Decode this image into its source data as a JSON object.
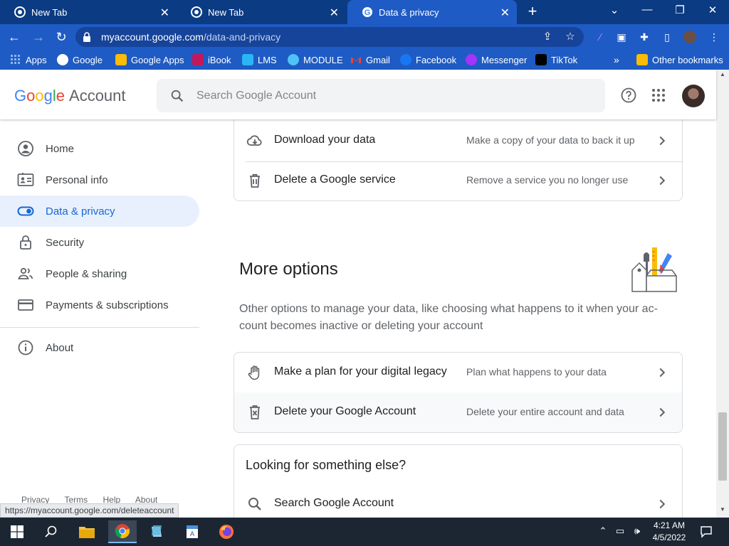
{
  "browser": {
    "tabs": [
      {
        "title": "New Tab",
        "active": false
      },
      {
        "title": "New Tab",
        "active": false
      },
      {
        "title": "Data & privacy",
        "active": true
      }
    ],
    "url_host": "myaccount.google.com",
    "url_path": "/data-and-privacy",
    "bookmarks": [
      "Apps",
      "Google",
      "Google Apps",
      "iBook",
      "LMS",
      "MODULE",
      "Gmail",
      "Facebook",
      "Messenger",
      "TikTok"
    ],
    "other_bookmarks": "Other bookmarks",
    "status_url": "https://myaccount.google.com/deleteaccount"
  },
  "header": {
    "logo_word": "Google",
    "logo_product": "Account",
    "search_placeholder": "Search Google Account"
  },
  "sidebar": {
    "items": [
      {
        "label": "Home",
        "icon": "home-icon"
      },
      {
        "label": "Personal info",
        "icon": "id-card-icon"
      },
      {
        "label": "Data & privacy",
        "icon": "toggle-icon",
        "active": true
      },
      {
        "label": "Security",
        "icon": "lock-icon"
      },
      {
        "label": "People & sharing",
        "icon": "people-icon"
      },
      {
        "label": "Payments & subscriptions",
        "icon": "credit-card-icon"
      }
    ],
    "about": "About",
    "footer": [
      "Privacy",
      "Terms",
      "Help",
      "About"
    ]
  },
  "main": {
    "top_rows": [
      {
        "title": "Download your data",
        "desc": "Make a copy of your data to back it up"
      },
      {
        "title": "Delete a Google service",
        "desc": "Remove a service you no longer use"
      }
    ],
    "more_options": {
      "title": "More options",
      "desc": "Other options to manage your data, like choosing what happens to it when your ac-count becomes inactive or deleting your account",
      "rows": [
        {
          "title": "Make a plan for your digital legacy",
          "desc": "Plan what happens to your data"
        },
        {
          "title": "Delete your Google Account",
          "desc": "Delete your entire account and data"
        }
      ]
    },
    "looking_else": {
      "title": "Looking for something else?",
      "search_row": "Search Google Account"
    }
  },
  "taskbar": {
    "time": "4:21 AM",
    "date": "4/5/2022"
  },
  "colors": {
    "tab_bar": "#0b3b82",
    "toolbar": "#1f5bc4",
    "active_nav_bg": "#e8f0fe",
    "active_nav_text": "#1967d2",
    "taskbar": "#1c2633"
  }
}
